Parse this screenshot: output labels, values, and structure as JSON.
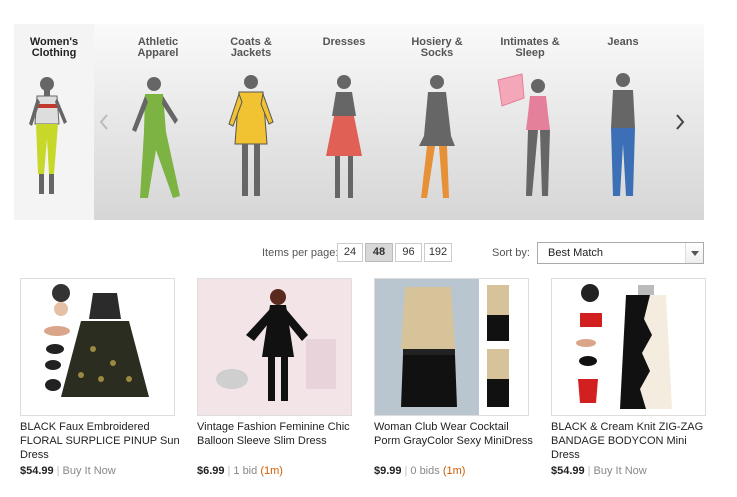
{
  "categories": [
    {
      "label": "Women's Clothing",
      "active": true
    },
    {
      "label": "Athletic Apparel"
    },
    {
      "label": "Coats & Jackets"
    },
    {
      "label": "Dresses"
    },
    {
      "label": "Hosiery & Socks"
    },
    {
      "label": "Intimates & Sleep"
    },
    {
      "label": "Jeans"
    }
  ],
  "carousel": {
    "prev_icon": "chevron-left-icon",
    "next_icon": "chevron-right-icon"
  },
  "controls": {
    "items_per_page_label": "Items per page:",
    "items_per_page_options": [
      "24",
      "48",
      "96",
      "192"
    ],
    "items_per_page_selected": "48",
    "sort_label": "Sort by:",
    "sort_value": "Best Match"
  },
  "colors": {
    "accent_orange": "#d05a00",
    "muted_text": "#888888",
    "selected_button": "#d8d8d8"
  },
  "products": [
    {
      "title": "BLACK Faux Embroidered FLORAL SURPLICE PINUP Sun Dress",
      "price": "$54.99",
      "meta": "Buy It Now",
      "time": ""
    },
    {
      "title": "Vintage Fashion Feminine Chic Balloon Sleeve Slim Dress",
      "price": "$6.99",
      "meta": "1 bid",
      "time": "(1m)"
    },
    {
      "title": "Woman Club Wear Cocktail Porm GrayColor Sexy MiniDress",
      "price": "$9.99",
      "meta": "0 bids",
      "time": "(1m)"
    },
    {
      "title": "BLACK & Cream Knit ZIG-ZAG BANDAGE BODYCON Mini Dress",
      "price": "$54.99",
      "meta": "Buy It Now",
      "time": ""
    }
  ]
}
